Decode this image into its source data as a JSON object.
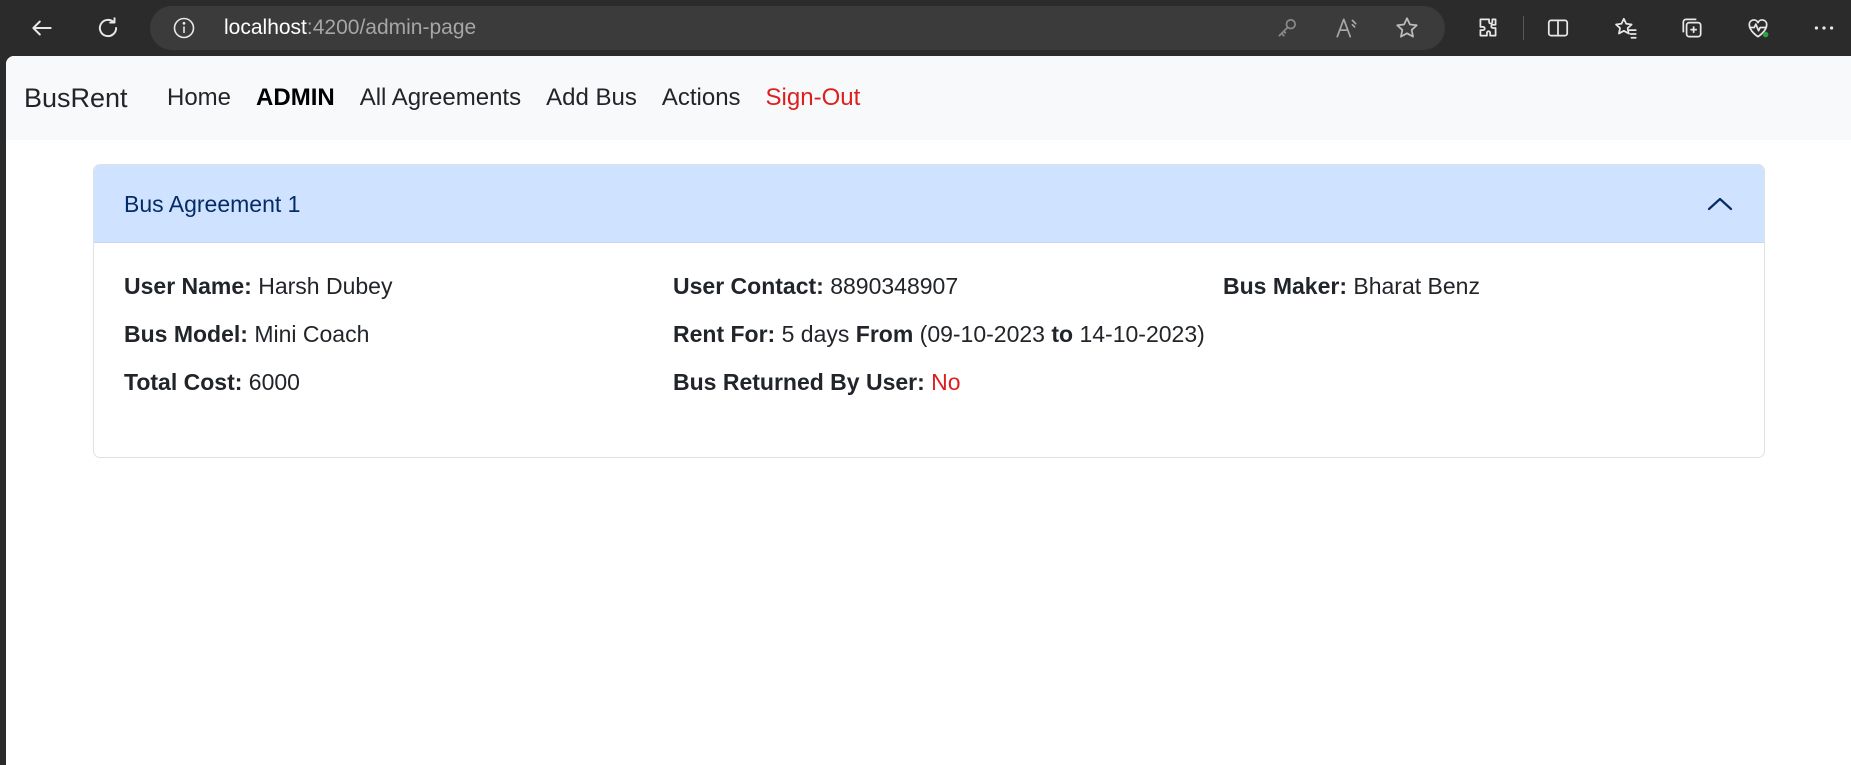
{
  "browser": {
    "url_host": "localhost",
    "url_path": ":4200/admin-page",
    "icons": [
      "back-icon",
      "refresh-icon",
      "info-icon",
      "key-icon",
      "read-aloud-icon",
      "star-icon",
      "extensions-icon",
      "split-screen-icon",
      "favorites-icon",
      "collections-icon",
      "health-icon",
      "more-icon"
    ]
  },
  "navbar": {
    "brand": "BusRent",
    "links": [
      "Home",
      "ADMIN",
      "All Agreements",
      "Add Bus",
      "Actions",
      "Sign-Out"
    ]
  },
  "agreement": {
    "title": "Bus Agreement 1",
    "user_name_label": "User Name:",
    "user_name": "Harsh Dubey",
    "user_contact_label": "User Contact:",
    "user_contact": "8890348907",
    "bus_maker_label": "Bus Maker:",
    "bus_maker": "Bharat Benz",
    "bus_model_label": "Bus Model:",
    "bus_model": "Mini Coach",
    "rent_for_label": "Rent For:",
    "rent_for": "5 days",
    "from_label": "From",
    "from_date": "(09-10-2023",
    "to_label": "to",
    "to_date": "14-10-2023)",
    "total_cost_label": "Total Cost:",
    "total_cost": "6000",
    "returned_label": "Bus Returned By User:",
    "returned": "No"
  },
  "colors": {
    "accent_header": "#cfe2ff",
    "danger": "#dc1f1f",
    "navbar_bg": "#f8f9fa"
  }
}
